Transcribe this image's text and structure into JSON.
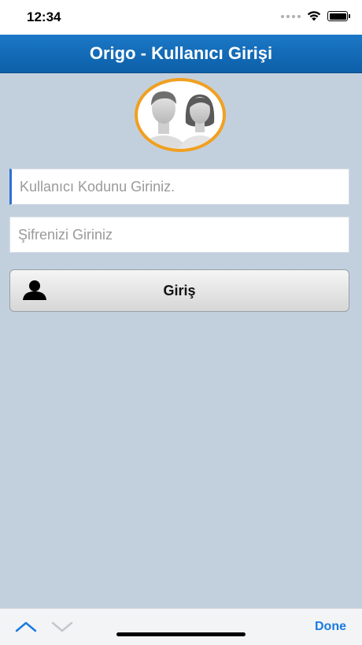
{
  "status_bar": {
    "time": "12:34",
    "icons": [
      "signal-dots-icon",
      "wifi-icon",
      "battery-icon"
    ]
  },
  "header": {
    "title": "Origo - Kullanıcı Girişi",
    "color": "#1b78c6"
  },
  "avatar": {
    "icon": "users-avatar-icon",
    "ring_color": "#f0a020"
  },
  "form": {
    "username_placeholder": "Kullanıcı Kodunu Giriniz.",
    "username_value": "",
    "password_placeholder": "Şifrenizi Giriniz",
    "password_value": "",
    "login_label": "Giriş",
    "login_icon": "user-icon"
  },
  "keyboard_toolbar": {
    "prev_icon": "chevron-up-icon",
    "next_icon": "chevron-down-icon",
    "done_label": "Done",
    "accent": "#1a7be0"
  }
}
